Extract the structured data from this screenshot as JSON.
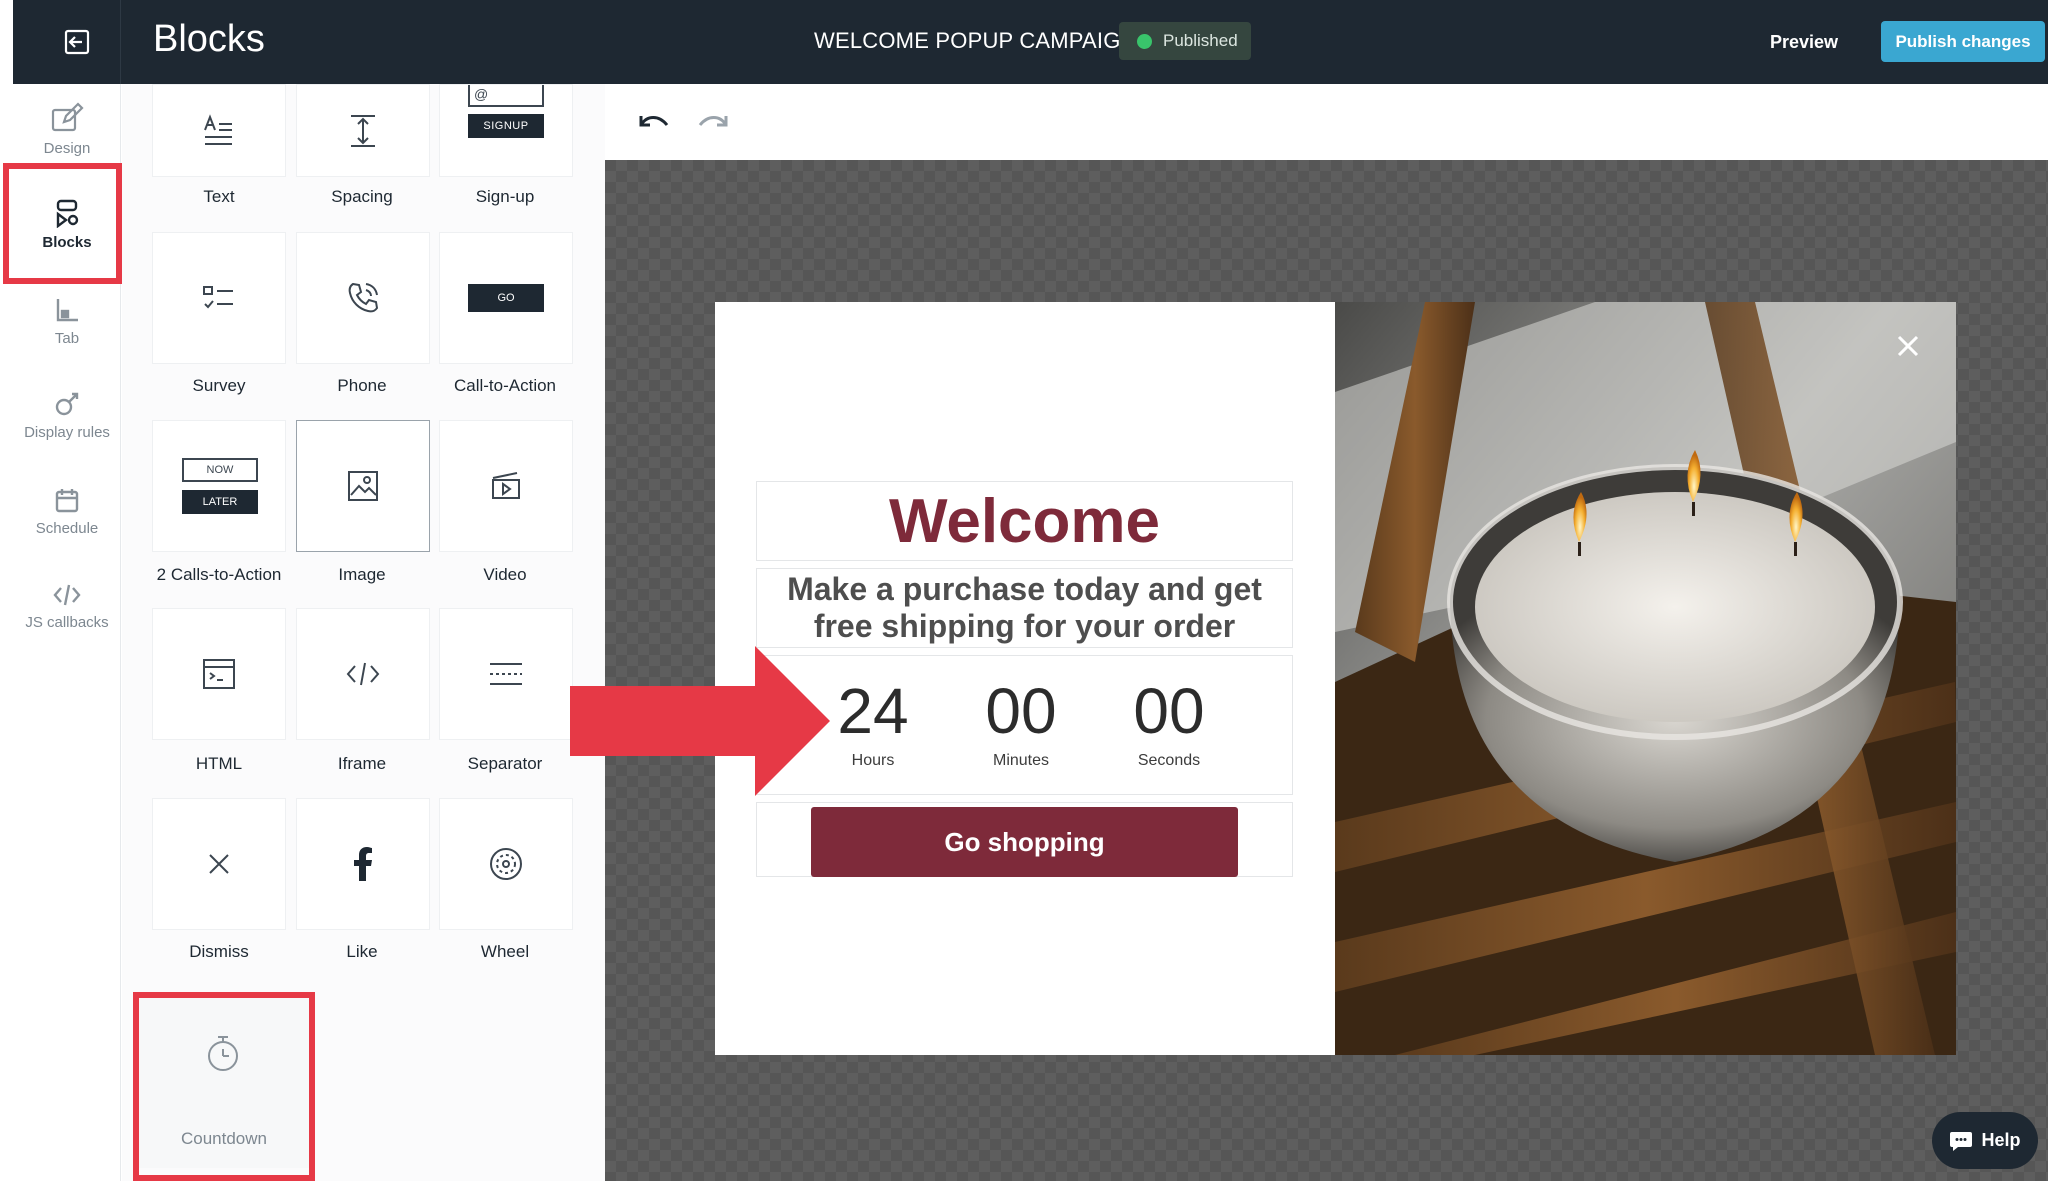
{
  "header": {
    "app_title": "Blocks",
    "campaign_title": "WELCOME POPUP CAMPAIGN",
    "status": "Published",
    "preview_label": "Preview",
    "publish_label": "Publish changes"
  },
  "rail": {
    "items": [
      {
        "label": "Design",
        "icon": "design-icon"
      },
      {
        "label": "Blocks",
        "icon": "blocks-icon",
        "active": true
      },
      {
        "label": "Tab",
        "icon": "tab-icon"
      },
      {
        "label": "Display rules",
        "icon": "display-rules-icon"
      },
      {
        "label": "Schedule",
        "icon": "calendar-icon"
      },
      {
        "label": "JS callbacks",
        "icon": "code-icon"
      }
    ]
  },
  "blocks": {
    "items": [
      {
        "label": "Text"
      },
      {
        "label": "Spacing"
      },
      {
        "label": "Sign-up",
        "icon_text": "SIGNUP",
        "icon_at": "@"
      },
      {
        "label": "Survey"
      },
      {
        "label": "Phone"
      },
      {
        "label": "Call-to-Action",
        "icon_text": "GO"
      },
      {
        "label": "2 Calls-to-Action",
        "icon_text_1": "NOW",
        "icon_text_2": "LATER"
      },
      {
        "label": "Image",
        "selected": true
      },
      {
        "label": "Video"
      },
      {
        "label": "HTML"
      },
      {
        "label": "Iframe"
      },
      {
        "label": "Separator"
      },
      {
        "label": "Dismiss"
      },
      {
        "label": "Like"
      },
      {
        "label": "Wheel"
      },
      {
        "label": "Countdown"
      }
    ]
  },
  "popup": {
    "heading": "Welcome",
    "subtext": "Make a purchase today and get free shipping for your order",
    "countdown": [
      {
        "value": "24",
        "label": "Hours"
      },
      {
        "value": "00",
        "label": "Minutes"
      },
      {
        "value": "00",
        "label": "Seconds"
      }
    ],
    "cta_label": "Go shopping"
  },
  "help": {
    "label": "Help"
  },
  "colors": {
    "topbar": "#1e2832",
    "accent": "#3aa7d1",
    "brand": "#7e2a3a",
    "highlight": "#e63946",
    "status_green": "#39c46b"
  }
}
